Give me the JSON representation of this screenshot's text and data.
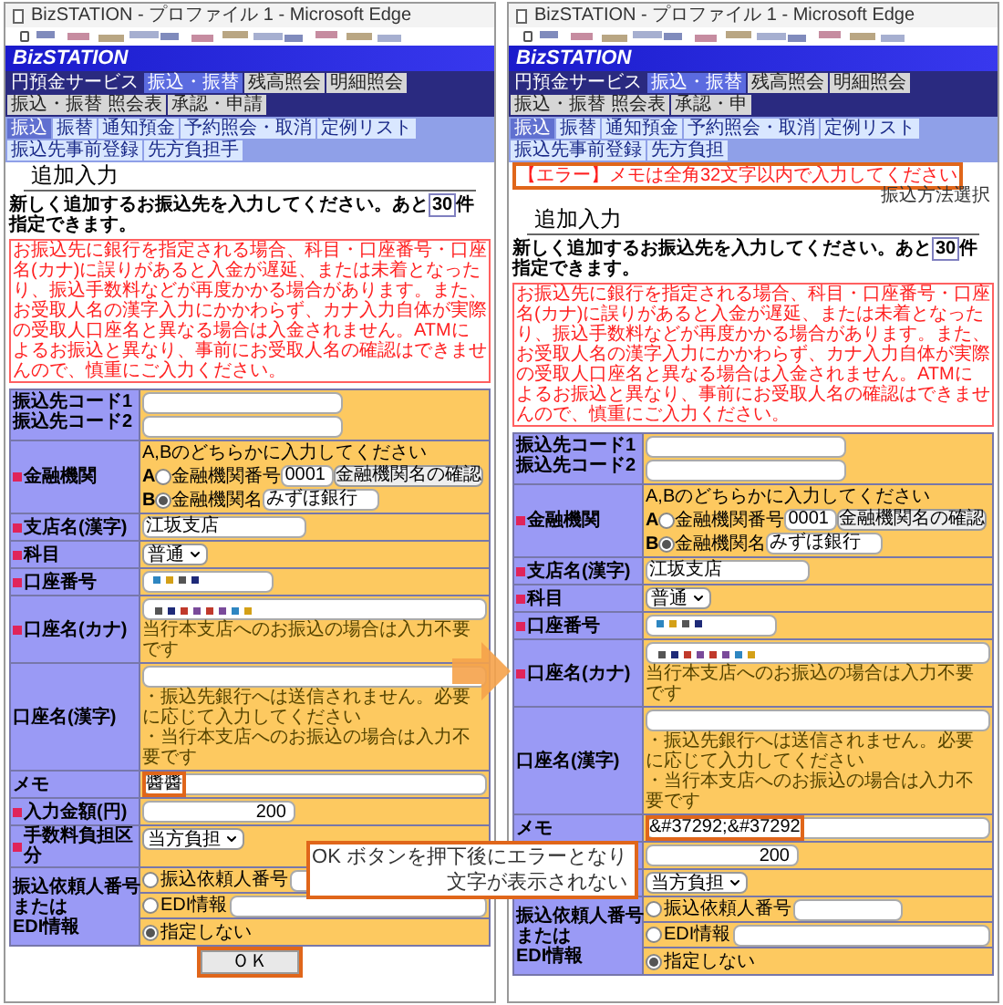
{
  "windows": [
    {
      "title": "BizSTATION - プロファイル 1 - Microsoft Edge",
      "logo": "BizSTATION",
      "service_label": "円預金サービス",
      "main_tabs": [
        {
          "label": "振込・振替",
          "selected": true
        },
        {
          "label": "残高照会",
          "selected": false
        },
        {
          "label": "明細照会",
          "selected": false
        },
        {
          "label": "振込・振替 照会表",
          "selected": false
        },
        {
          "label": "承認・申請",
          "selected": false
        }
      ],
      "sub_tabs": [
        {
          "label": "振込",
          "selected": true
        },
        {
          "label": "振替",
          "selected": false
        },
        {
          "label": "通知預金",
          "selected": false
        },
        {
          "label": "予約照会・取消",
          "selected": false
        },
        {
          "label": "定例リスト",
          "selected": false
        },
        {
          "label": "振込先事前登録",
          "selected": false
        },
        {
          "label": "先方負担手",
          "selected": false
        }
      ],
      "heading": "追加入力",
      "intro_before": "新しく追加するお振込先を入力してください。あと",
      "remaining": "30",
      "intro_after": "件指定できます。",
      "notice": "お振込先に銀行を指定される場合、科目・口座番号・口座名(カナ)に誤りがあると入金が遅延、または未着となったり、振込手数料などが再度かかる場合があります。また、お受取人名の漢字入力にかかわらず、カナ入力自体が実際の受取人口座名と異なる場合は入金されません。ATMによるお振込と異なり、事前にお受取人名の確認はできませんので、慎重にご入力ください。",
      "rows": [
        {
          "kind": "codes",
          "labels": [
            "振込先コード1",
            "振込先コード2"
          ]
        },
        {
          "kind": "bank",
          "label": "金融機関",
          "required": true,
          "hint": "A,Bのどちらかに入力してください",
          "options": [
            {
              "letter": "A",
              "label": "金融機関番号",
              "value": "0001",
              "selected": false,
              "button": "金融機関名の確認"
            },
            {
              "letter": "B",
              "label": "金融機関名",
              "value": "みずほ銀行",
              "selected": true
            }
          ]
        },
        {
          "kind": "text",
          "label": "支店名(漢字)",
          "required": true,
          "value": "江坂支店"
        },
        {
          "kind": "select",
          "label": "科目",
          "required": true,
          "value": "普通"
        },
        {
          "kind": "masked",
          "label": "口座番号",
          "required": true
        },
        {
          "kind": "masked",
          "label": "口座名(カナ)",
          "required": true,
          "notes": [
            "当行本支店へのお振込の場合は入力不要です"
          ]
        },
        {
          "kind": "text",
          "label": "口座名(漢字)",
          "required": false,
          "notes": [
            "・振込先銀行へは送信されません。必要に応じて入力してください",
            "・当行本支店へのお振込の場合は入力不要です"
          ]
        },
        {
          "kind": "text",
          "label": "メモ",
          "required": false,
          "value": "醬醬",
          "highlighted": true
        },
        {
          "kind": "amount",
          "label": "入力金額(円)",
          "required": true,
          "value": "200"
        },
        {
          "kind": "select",
          "label": "手数料負担区分",
          "required": true,
          "value": "当方負担"
        },
        {
          "kind": "requester",
          "label_lines": [
            "振込依頼人番号",
            "または",
            "EDI情報"
          ],
          "required": false,
          "options": [
            {
              "label": "振込依頼人番号",
              "selected": false,
              "kind": "short_field"
            },
            {
              "label": "EDI情報",
              "selected": false,
              "kind": "wide_field"
            },
            {
              "label": "指定しない",
              "selected": true,
              "kind": "plain"
            }
          ]
        }
      ],
      "ok_button": {
        "label": "ＯＫ",
        "highlighted": true
      }
    },
    {
      "title": "BizSTATION - プロファイル 1 - Microsoft Edge",
      "logo": "BizSTATION",
      "service_label": "円預金サービス",
      "main_tabs": [
        {
          "label": "振込・振替",
          "selected": true
        },
        {
          "label": "残高照会",
          "selected": false
        },
        {
          "label": "明細照会",
          "selected": false
        },
        {
          "label": "振込・振替 照会表",
          "selected": false
        },
        {
          "label": "承認・申",
          "selected": false
        }
      ],
      "sub_tabs": [
        {
          "label": "振込",
          "selected": true
        },
        {
          "label": "振替",
          "selected": false
        },
        {
          "label": "通知預金",
          "selected": false
        },
        {
          "label": "予約照会・取消",
          "selected": false
        },
        {
          "label": "定例リスト",
          "selected": false
        },
        {
          "label": "振込先事前登録",
          "selected": false
        },
        {
          "label": "先方負担",
          "selected": false
        }
      ],
      "error": {
        "text": "【エラー】メモは全角32文字以内で入力してください",
        "highlighted": true
      },
      "method_hint": "振込方法選択",
      "heading": "追加入力",
      "intro_before": "新しく追加するお振込先を入力してください。あと",
      "remaining": "30",
      "intro_after": "件指定できます。",
      "notice": "お振込先に銀行を指定される場合、科目・口座番号・口座名(カナ)に誤りがあると入金が遅延、または未着となったり、振込手数料などが再度かかる場合があります。また、お受取人名の漢字入力にかかわらず、カナ入力自体が実際の受取人口座名と異なる場合は入金されません。ATMによるお振込と異なり、事前にお受取人名の確認はできませんので、慎重にご入力ください。",
      "rows": [
        {
          "kind": "codes",
          "labels": [
            "振込先コード1",
            "振込先コード2"
          ]
        },
        {
          "kind": "bank",
          "label": "金融機関",
          "required": true,
          "hint": "A,Bのどちらかに入力してください",
          "options": [
            {
              "letter": "A",
              "label": "金融機関番号",
              "value": "0001",
              "selected": false,
              "button": "金融機関名の確認"
            },
            {
              "letter": "B",
              "label": "金融機関名",
              "value": "みずほ銀行",
              "selected": true
            }
          ]
        },
        {
          "kind": "text",
          "label": "支店名(漢字)",
          "required": true,
          "value": "江坂支店"
        },
        {
          "kind": "select",
          "label": "科目",
          "required": true,
          "value": "普通"
        },
        {
          "kind": "masked",
          "label": "口座番号",
          "required": true
        },
        {
          "kind": "masked",
          "label": "口座名(カナ)",
          "required": true,
          "notes": [
            "当行本支店へのお振込の場合は入力不要です"
          ]
        },
        {
          "kind": "text",
          "label": "口座名(漢字)",
          "required": false,
          "notes": [
            "・振込先銀行へは送信されません。必要に応じて入力してください",
            "・当行本支店へのお振込の場合は入力不要です"
          ]
        },
        {
          "kind": "text",
          "label": "メモ",
          "required": false,
          "value": "&#37292;&#37292",
          "highlighted": true
        },
        {
          "kind": "amount",
          "required": false,
          "value": "200"
        },
        {
          "kind": "select",
          "required": false,
          "value": "当方負担"
        },
        {
          "kind": "requester",
          "label_lines": [
            "振込依頼人番号",
            "または",
            "EDI情報"
          ],
          "required": false,
          "options": [
            {
              "label": "振込依頼人番号",
              "selected": false,
              "kind": "short_field"
            },
            {
              "label": "EDI情報",
              "selected": false,
              "kind": "wide_field"
            },
            {
              "label": "指定しない",
              "selected": true,
              "kind": "plain"
            }
          ]
        }
      ]
    }
  ],
  "callout": {
    "lines": [
      "OK ボタンを押下後にエラーとなり",
      "文字が表示されない"
    ]
  }
}
